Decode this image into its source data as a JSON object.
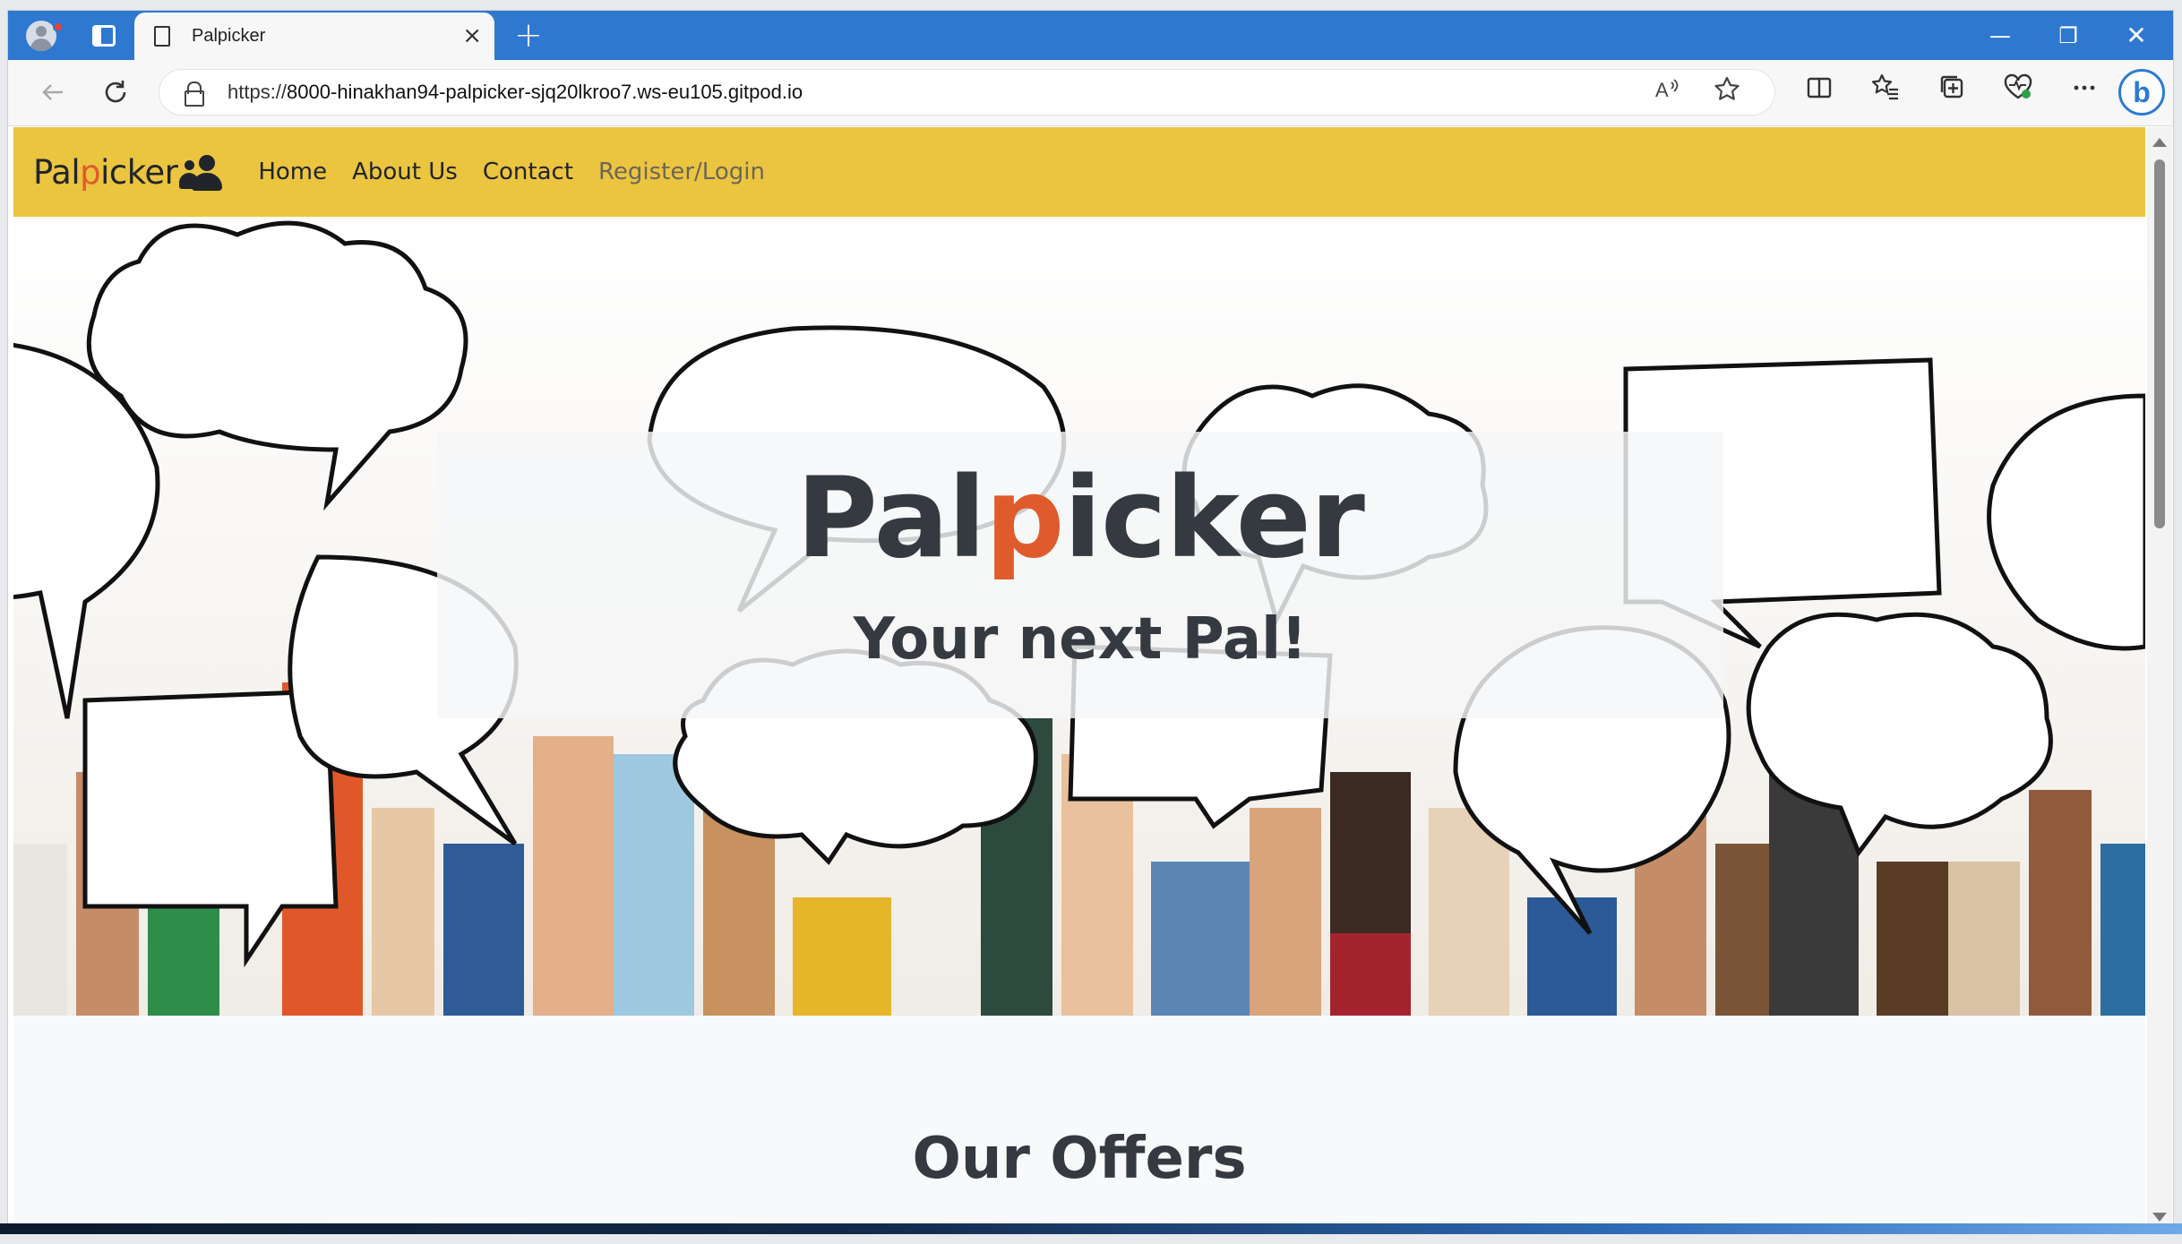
{
  "browser": {
    "tab_title": "Palpicker",
    "tab_close": "×",
    "new_tab": "+",
    "url_prefix": "https://",
    "url_host": "8000-hinakhan94-palpicker-sjq20lkroo7.ws-eu105.gitpod.io",
    "window_controls": {
      "minimize": "—",
      "maximize": "❐",
      "close": "✕"
    },
    "icons": [
      "profile-icon",
      "workspaces-icon",
      "page-icon",
      "back-icon",
      "refresh-icon",
      "lock-icon",
      "read-aloud-icon",
      "favorite-star-icon",
      "split-screen-icon",
      "favorites-icon",
      "collections-icon",
      "browser-essentials-icon",
      "more-icon",
      "bing-copilot-icon"
    ]
  },
  "site": {
    "brand": {
      "pre": "Pal",
      "highlight": "p",
      "post": "icker"
    },
    "nav": {
      "home": "Home",
      "about": "About Us",
      "contact": "Contact",
      "register": "Register/Login"
    },
    "hero": {
      "title_pre": "Pal",
      "title_highlight": "p",
      "title_post": "icker",
      "subtitle": "Your next Pal!"
    },
    "section_heading": "Our Offers",
    "colors": {
      "navbar": "#ebc440",
      "accent": "#e05b2c",
      "text": "#343a40"
    }
  }
}
